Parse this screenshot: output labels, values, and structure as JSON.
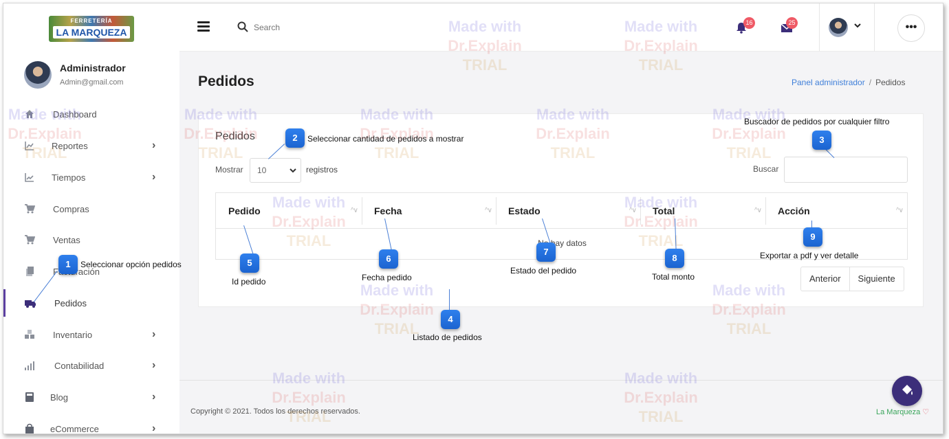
{
  "logo": {
    "top": "FERRETERÍA",
    "main": "LA MARQUEZA"
  },
  "profile": {
    "name": "Administrador",
    "email": "Admin@gmail.com"
  },
  "sidebar": {
    "items": [
      {
        "label": "Dashboard",
        "icon": "home-icon",
        "chevron": false
      },
      {
        "label": "Reportes",
        "icon": "chart-icon",
        "chevron": true
      },
      {
        "label": "Tiempos",
        "icon": "trend-icon",
        "chevron": true
      },
      {
        "label": "Compras",
        "icon": "cart-icon",
        "chevron": false
      },
      {
        "label": "Ventas",
        "icon": "cart-icon",
        "chevron": false
      },
      {
        "label": "Facturación",
        "icon": "documents-icon",
        "chevron": false
      },
      {
        "label": "Pedidos",
        "icon": "truck-icon",
        "chevron": false,
        "active": true
      },
      {
        "label": "Inventario",
        "icon": "boxes-icon",
        "chevron": true
      },
      {
        "label": "Contabilidad",
        "icon": "signal-icon",
        "chevron": true
      },
      {
        "label": "Blog",
        "icon": "book-icon",
        "chevron": true
      },
      {
        "label": "eCommerce",
        "icon": "bag-icon",
        "chevron": true
      }
    ]
  },
  "topbar": {
    "search_placeholder": "Search",
    "notifications_count": "16",
    "messages_count": "25",
    "more_label": "•••"
  },
  "page": {
    "title": "Pedidos",
    "breadcrumb": {
      "link": "Panel administrador",
      "separator": "/",
      "current": "Pedidos"
    }
  },
  "card": {
    "title": "Pedidos",
    "length_label": "Mostrar",
    "length_value": "10",
    "length_suffix": "registros",
    "search_label": "Buscar",
    "columns": [
      "Pedido",
      "Fecha",
      "Estado",
      "Total",
      "Acción"
    ],
    "empty_text": "No hay datos",
    "pager": {
      "prev": "Anterior",
      "next": "Siguiente"
    }
  },
  "footer": {
    "copyright": "Copyright © 2021. Todos los derechos reservados.",
    "brand": "La Marqueza",
    "heart": "♡"
  },
  "watermark": {
    "line1": "Made with",
    "line2": "Dr.Explain",
    "line3": "TRIAL"
  },
  "callouts": [
    {
      "num": "1",
      "text": "Seleccionar opción pedidos"
    },
    {
      "num": "2",
      "text": "Seleccionar cantidad de pedidos a mostrar"
    },
    {
      "num": "3",
      "text": "Buscador de pedidos por cualquier filtro"
    },
    {
      "num": "4",
      "text": "Listado de pedidos"
    },
    {
      "num": "5",
      "text": "Id pedido"
    },
    {
      "num": "6",
      "text": "Fecha pedido"
    },
    {
      "num": "7",
      "text": "Estado del pedido"
    },
    {
      "num": "8",
      "text": "Total monto"
    },
    {
      "num": "9",
      "text": "Exportar a pdf y ver detalle"
    }
  ],
  "colors": {
    "accent": "#5b3fa0",
    "link": "#3f7fd9",
    "badge": "#ef5a66",
    "callout": "#1f6fe0",
    "brand": "#3aa55b"
  }
}
